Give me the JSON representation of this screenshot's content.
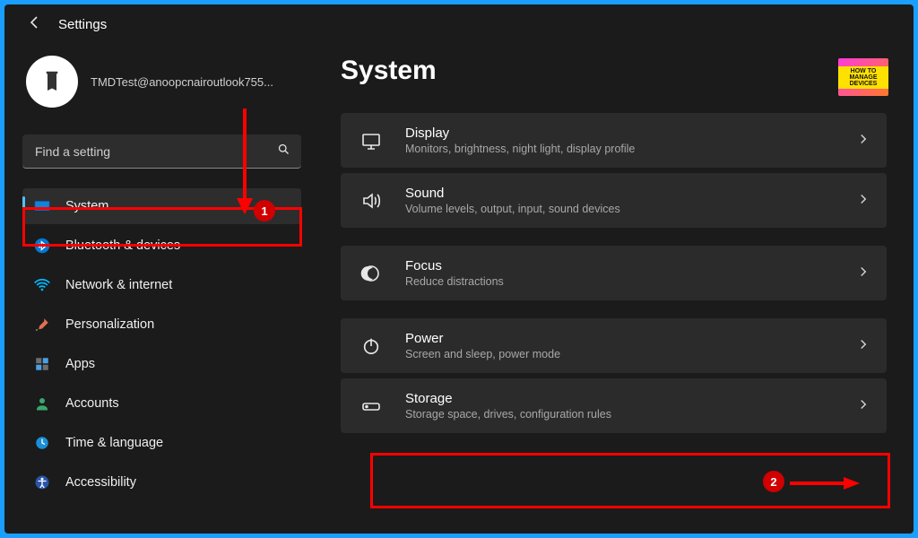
{
  "window": {
    "title": "Settings"
  },
  "profile": {
    "email": "TMDTest@anoopcnairoutlook755..."
  },
  "search": {
    "placeholder": "Find a setting"
  },
  "sidebar": {
    "items": [
      {
        "label": "System"
      },
      {
        "label": "Bluetooth & devices"
      },
      {
        "label": "Network & internet"
      },
      {
        "label": "Personalization"
      },
      {
        "label": "Apps"
      },
      {
        "label": "Accounts"
      },
      {
        "label": "Time & language"
      },
      {
        "label": "Accessibility"
      }
    ]
  },
  "main": {
    "heading": "System",
    "rows": [
      {
        "title": "Display",
        "desc": "Monitors, brightness, night light, display profile"
      },
      {
        "title": "Sound",
        "desc": "Volume levels, output, input, sound devices"
      },
      {
        "title": "Focus",
        "desc": "Reduce distractions"
      },
      {
        "title": "Power",
        "desc": "Screen and sleep, power mode"
      },
      {
        "title": "Storage",
        "desc": "Storage space, drives, configuration rules"
      }
    ]
  },
  "annotations": {
    "badge1": "1",
    "badge2": "2"
  },
  "watermark": "HOW TO MANAGE DEVICES"
}
